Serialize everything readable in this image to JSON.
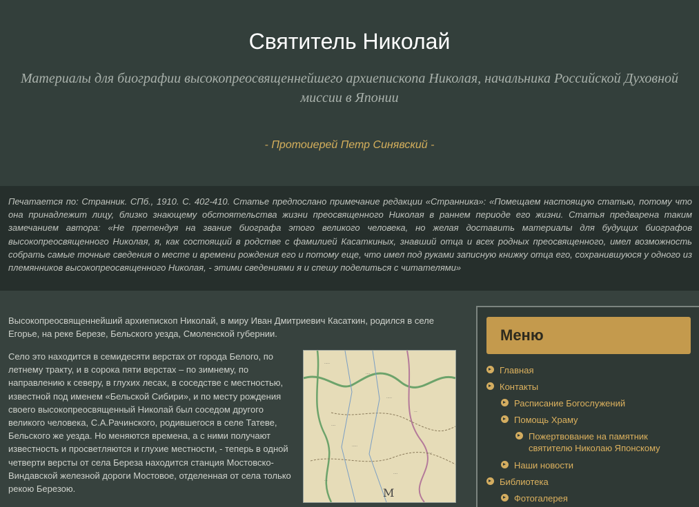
{
  "header": {
    "title": "Святитель Николай",
    "subtitle": "Материалы для биографии высокопреосвященнейшего архиепископа Николая, начальника Российской Духовной миссии в Японии",
    "author_prefix": "- ",
    "author": "Протоиерей Петр Синявский",
    "author_suffix": " -"
  },
  "note": {
    "text": "Печатается по: Странник. СПб., 1910. С. 402-410. Статье предпослано примечание редакции «Странника»: «Помещаем настоящую статью, потому что она принадлежит лицу, близко знающему обстоятельства жизни преосвященного Николая в раннем периоде его жизни. Статья предварена таким замечанием автора: «Не претендуя на звание биографа этого великого человека, но желая доставить материалы для будущих биографов высокопреосвященного Николая, я, как состоящий в родстве с фамилией Касаткиных, знавший отца и всех родных преосвященного, имел возможность собрать самые точные сведения о месте и времени рождения его и потому еще, что имел под руками записную книжку отца его, сохранившуюся у одного из племянников высокопреосвященного Николая, - этими сведениями я и спешу поделиться с читателями»"
  },
  "content": {
    "intro": "Высокопреосвященнейший архиепископ Николай, в миру Иван Дмитриевич Касаткин, родился в селе Егорье, на реке Березе, Бельского уезда, Смоленской губернии.",
    "para2": "Село это находится в семидесяти верстах от города Белого, по летнему тракту, и в сорока пяти верстах – по зимнему, по направлению к северу, в глухих лесах, в соседстве с местностью, известной под именем «Бельской Сибири», и по месту рождения своего высокопреосвященный Николай был соседом другого великого человека, С.А.Рачинского, родившегося в селе Татеве, Бельского же уезда. Но меняются времена, а с ними получают известность и просветляются и глухие местности, - теперь в одной четверти версты от села Береза находится станция Мостовско-Виндавской железной дороги Мостовое, отделенная от села только рекою Березою.",
    "map_label": "М"
  },
  "sidebar": {
    "menu_title": "Меню",
    "items": [
      {
        "label": "Главная"
      },
      {
        "label": "Контакты"
      },
      {
        "label": "Расписание Богослужений"
      },
      {
        "label": "Помощь Храму"
      },
      {
        "label": "Пожертвование на памятник святителю Николаю Японскому"
      },
      {
        "label": "Наши новости"
      },
      {
        "label": "Библиотека"
      },
      {
        "label": "Фотогалерея"
      }
    ]
  },
  "colors": {
    "accent": "#c49a4d",
    "link": "#dcb15e",
    "background": "#37423e"
  }
}
